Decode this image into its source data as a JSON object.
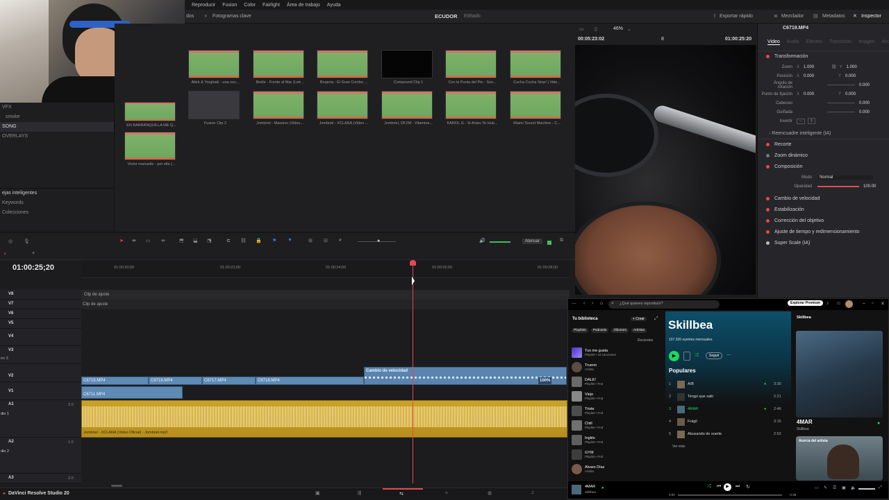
{
  "menu": [
    "Reproducir",
    "Fusion",
    "Color",
    "Fairlight",
    "Área de trabajo",
    "Ayuda"
  ],
  "toolbar": {
    "keyframes": "Fotogramas clave",
    "project": "ECUDOR",
    "status": "Editado",
    "export": "Exportar rápido",
    "mixer": "Mezclador",
    "metadata": "Metadatos",
    "inspector": "Inspector",
    "left_stub": "dos"
  },
  "bins": {
    "items": [
      "VFX",
      "smoke",
      "SONG",
      "OVERLAYS"
    ],
    "smart_title": "ejas inteligentes",
    "smart_items": [
      "Keywords",
      "Colecciones"
    ]
  },
  "clips": [
    {
      "name": "Alleh & Yorghaki - una noc...",
      "kind": "audio"
    },
    {
      "name": "Beéle - Frente al Mar (Letr...",
      "kind": "audio"
    },
    {
      "name": "Brujería - El Gran Combo ...",
      "kind": "audio"
    },
    {
      "name": "Compound Clip 1",
      "kind": "black"
    },
    {
      "name": "Con la Punta del Pie - Son...",
      "kind": "audio"
    },
    {
      "name": "Cucha Cucha Stop! | Vide...",
      "kind": "audio"
    },
    {
      "name": "EN BARRANQUILLA ME Q...",
      "kind": "audio"
    },
    {
      "name": "Fusion Clip 2",
      "kind": "gray"
    },
    {
      "name": "Jombriel - Masoivo (Video...",
      "kind": "audio"
    },
    {
      "name": "Jombriel - XCLANA (Video ...",
      "kind": "audio"
    },
    {
      "name": "Jombriel, DFZM - Vitamina...",
      "kind": "audio"
    },
    {
      "name": "KAROL G - Si Antes Te Hub...",
      "kind": "audio"
    },
    {
      "name": "Miami Sound Machine - C...",
      "kind": "audio"
    },
    {
      "name": "Victor manuelle - por ella (...",
      "kind": "audio"
    }
  ],
  "viewer": {
    "timecode_left": "00:05:23:02",
    "zoom": "46%",
    "page": "8",
    "timecode_right": "01:00:25:20",
    "clip_name": "C6719.MP4"
  },
  "inspector": {
    "tabs": [
      "Video",
      "Audio",
      "Efectos",
      "Transición",
      "Imagen",
      "Arc"
    ],
    "transform_title": "Transformación",
    "zoom_label": "Zoom",
    "zoom_x": "1.000",
    "zoom_y": "1.000",
    "pos_label": "Posición",
    "pos_x": "0.000",
    "pos_y": "0.000",
    "rot_label": "Ángulo de rotación",
    "rot_val": "0.000",
    "anchor_label": "Punto de fijación",
    "anchor_x": "0.000",
    "anchor_y": "0.000",
    "pitch_label": "Cabeceo",
    "pitch_val": "0.000",
    "yaw_label": "Guiñada",
    "yaw_val": "0.000",
    "flip_label": "Invertir",
    "smart_reframe": "Reencuadre inteligente (IA)",
    "sections": [
      "Recorte",
      "Zoom dinámico",
      "Composición"
    ],
    "mode_label": "Modo",
    "mode_val": "Normal",
    "opacity_label": "Opacidad",
    "opacity_val": "100.00",
    "sections2": [
      "Cambio de velocidad",
      "Estabilización",
      "Corrección del objetivo",
      "Ajuste de tiempo y redimensionamiento",
      "Super Scale (IA)"
    ]
  },
  "timeline": {
    "timecode": "01:00:25;20",
    "attenuate": "Atenuar",
    "ruler": [
      "01:00:20;00",
      "01:00:22;00",
      "01:00:24;00",
      "01:00:26;00",
      "01:00:28;00"
    ],
    "tracks": [
      "V8",
      "V7",
      "V6",
      "V5",
      "V4",
      "V3",
      "V2",
      "V1",
      "A1",
      "A2",
      "A3"
    ],
    "adjust_clip": "Clip de ajuste",
    "video3": "eo 3",
    "v2_clips": [
      "C6715.MP4",
      "C6716.MP4",
      "C6717.MP4",
      "C6718.MP4"
    ],
    "speed_change": "Cambio de velocidad",
    "speed_pct": "100%",
    "v1_clip": "C6711.MP4",
    "audio_clip": "Jombriel - XCLANA (Video Oficial) - Jombriel.mp3",
    "a1_name": "dio 1",
    "a1_level": "2.0",
    "a2_name": "dio 2",
    "a2_level": "1.0",
    "a3_level": "2.0"
  },
  "bottom": {
    "app": "DaVinci Resolve Studio 20"
  },
  "spotify": {
    "search": "¿Qué quieres reproducir?",
    "premium": "Explorar Premium",
    "library": "Tu biblioteca",
    "create": "+ Crear",
    "filters": [
      "Playlists",
      "Podcasts",
      "Álbumes",
      "Artistas"
    ],
    "recent": "Recientes",
    "items": [
      {
        "name": "Tus me gusta",
        "sub": "Playlist • 44 canciones"
      },
      {
        "name": "Trueno",
        "sub": "Artista"
      },
      {
        "name": "DALE!",
        "sub": "Playlist • Fnd"
      },
      {
        "name": "Viejo",
        "sub": "Playlist • Fnd"
      },
      {
        "name": "Triste",
        "sub": "Playlist • Fnd"
      },
      {
        "name": "Chill",
        "sub": "Playlist • Fnd"
      },
      {
        "name": "Inglés",
        "sub": "Playlist • Fnd"
      },
      {
        "name": "GYM",
        "sub": "Playlist • Fnd"
      },
      {
        "name": "Alvaro Díaz",
        "sub": "Artista"
      }
    ],
    "artist": "Skillbea",
    "listeners": "107.320 oyentes mensuales",
    "follow": "Seguir",
    "popular": "Populares",
    "songs": [
      {
        "n": "1",
        "title": "A/B",
        "time": "3:30",
        "liked": true
      },
      {
        "n": "2",
        "title": "Tengo que salir",
        "time": "2:21",
        "liked": false
      },
      {
        "n": "3",
        "title": "4MAR",
        "time": "2:46",
        "liked": true
      },
      {
        "n": "4",
        "title": "Frágil",
        "time": "3:15",
        "liked": false
      },
      {
        "n": "5",
        "title": "Abusando de suerte",
        "time": "2:52",
        "liked": false
      }
    ],
    "see_more": "Ver más",
    "right_title": "Skillbea",
    "np_song": "4MAR",
    "np_artist": "Skillbea",
    "about": "Acerca del artista",
    "bar_song": "4MAR",
    "bar_artist": "Skillbea",
    "t_start": "0:00",
    "t_end": "-2:38"
  },
  "colors": {
    "accent_red": "#e14b4b",
    "audio_gold": "#c9a22a",
    "video_blue": "#5e8ab4",
    "spotify_green": "#1ed760"
  }
}
